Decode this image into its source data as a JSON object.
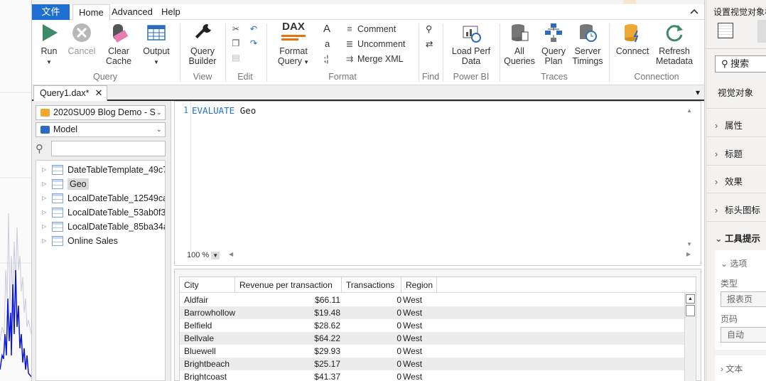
{
  "menu": {
    "file": "文件",
    "home": "Home",
    "advanced": "Advanced",
    "help": "Help",
    "collapse_icon": "chevron-up"
  },
  "ribbon": {
    "query": {
      "run": "Run",
      "cancel": "Cancel",
      "clear_cache_1": "Clear",
      "clear_cache_2": "Cache",
      "output": "Output",
      "group": "Query"
    },
    "view": {
      "query_builder_1": "Query",
      "query_builder_2": "Builder",
      "group": "View"
    },
    "edit": {
      "group": "Edit"
    },
    "format": {
      "format_query_1": "Format",
      "format_query_2": "Query",
      "comment": "Comment",
      "uncomment": "Uncomment",
      "merge_xml": "Merge XML",
      "group": "Format",
      "dax_logo": "DAX"
    },
    "find": {
      "group": "Find"
    },
    "powerbi": {
      "load_perf_1": "Load Perf",
      "load_perf_2": "Data",
      "group": "Power BI"
    },
    "traces": {
      "all_queries_1": "All",
      "all_queries_2": "Queries",
      "query_plan_1": "Query",
      "query_plan_2": "Plan",
      "server_timings_1": "Server",
      "server_timings_2": "Timings",
      "group": "Traces"
    },
    "connection": {
      "connect": "Connect",
      "refresh_1": "Refresh",
      "refresh_2": "Metadata",
      "group": "Connection"
    }
  },
  "doc_tab": {
    "label": "Query1.dax*",
    "close": "✕"
  },
  "metadata": {
    "database": "2020SU09 Blog Demo - S",
    "model": "Model",
    "search_value": "",
    "tables": [
      "DateTableTemplate_49c7",
      "Geo",
      "LocalDateTable_12549ca",
      "LocalDateTable_53ab0f3",
      "LocalDateTable_85ba34a",
      "Online Sales"
    ]
  },
  "editor": {
    "line_number": "1",
    "keyword": "EVALUATE",
    "expression": "Geo",
    "zoom": "100 %"
  },
  "results": {
    "columns": [
      "City",
      "Revenue per transaction",
      "Transactions",
      "Region"
    ],
    "rows": [
      [
        "Aldfair",
        "$66.11",
        "0",
        "West"
      ],
      [
        "Barrowhollow",
        "$19.48",
        "0",
        "West"
      ],
      [
        "Belfield",
        "$28.62",
        "0",
        "West"
      ],
      [
        "Bellvale",
        "$64.22",
        "0",
        "West"
      ],
      [
        "Bluewell",
        "$29.93",
        "0",
        "West"
      ],
      [
        "Brightbeach",
        "$25.17",
        "0",
        "West"
      ],
      [
        "Brightcoast",
        "$41.37",
        "0",
        "West"
      ]
    ]
  },
  "right_pane": {
    "title": "设置视觉对象格式",
    "search": "搜索",
    "visual_label": "视觉对象",
    "sections": [
      "属性",
      "标题",
      "效果",
      "标头图标",
      "工具提示"
    ],
    "options": "选项",
    "type_label": "类型",
    "type_value": "报表页",
    "page_label": "页码",
    "page_value": "自动",
    "text_section": "文本"
  },
  "colors": {
    "accent": "#1e6fd0",
    "run_green": "#3c8a66",
    "keyword_blue": "#1e6fd0"
  }
}
